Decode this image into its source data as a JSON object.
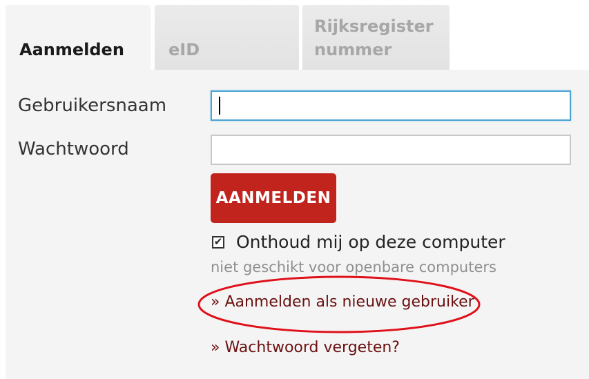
{
  "tabs": {
    "active": "Aanmelden",
    "eid": "eID",
    "rr_line1": "Rijksregister",
    "rr_line2": "nummer"
  },
  "form": {
    "username_label": "Gebruikersnaam",
    "username_value": "",
    "password_label": "Wachtwoord",
    "password_value": "",
    "submit_label": "AANMELDEN",
    "remember_label": "Onthoud mij op deze computer",
    "remember_checked": true,
    "check_glyph": "✔",
    "remember_note": "niet geschikt voor openbare computers"
  },
  "links": {
    "new_user": "» Aanmelden als nieuwe gebruiker",
    "forgot_password": "» Wachtwoord vergeten?"
  },
  "annotation": {
    "color": "#e0101a",
    "shape": "ellipse"
  },
  "colors": {
    "button": "#c1241d",
    "link": "#6b1111",
    "focus": "#4aa3d3"
  }
}
